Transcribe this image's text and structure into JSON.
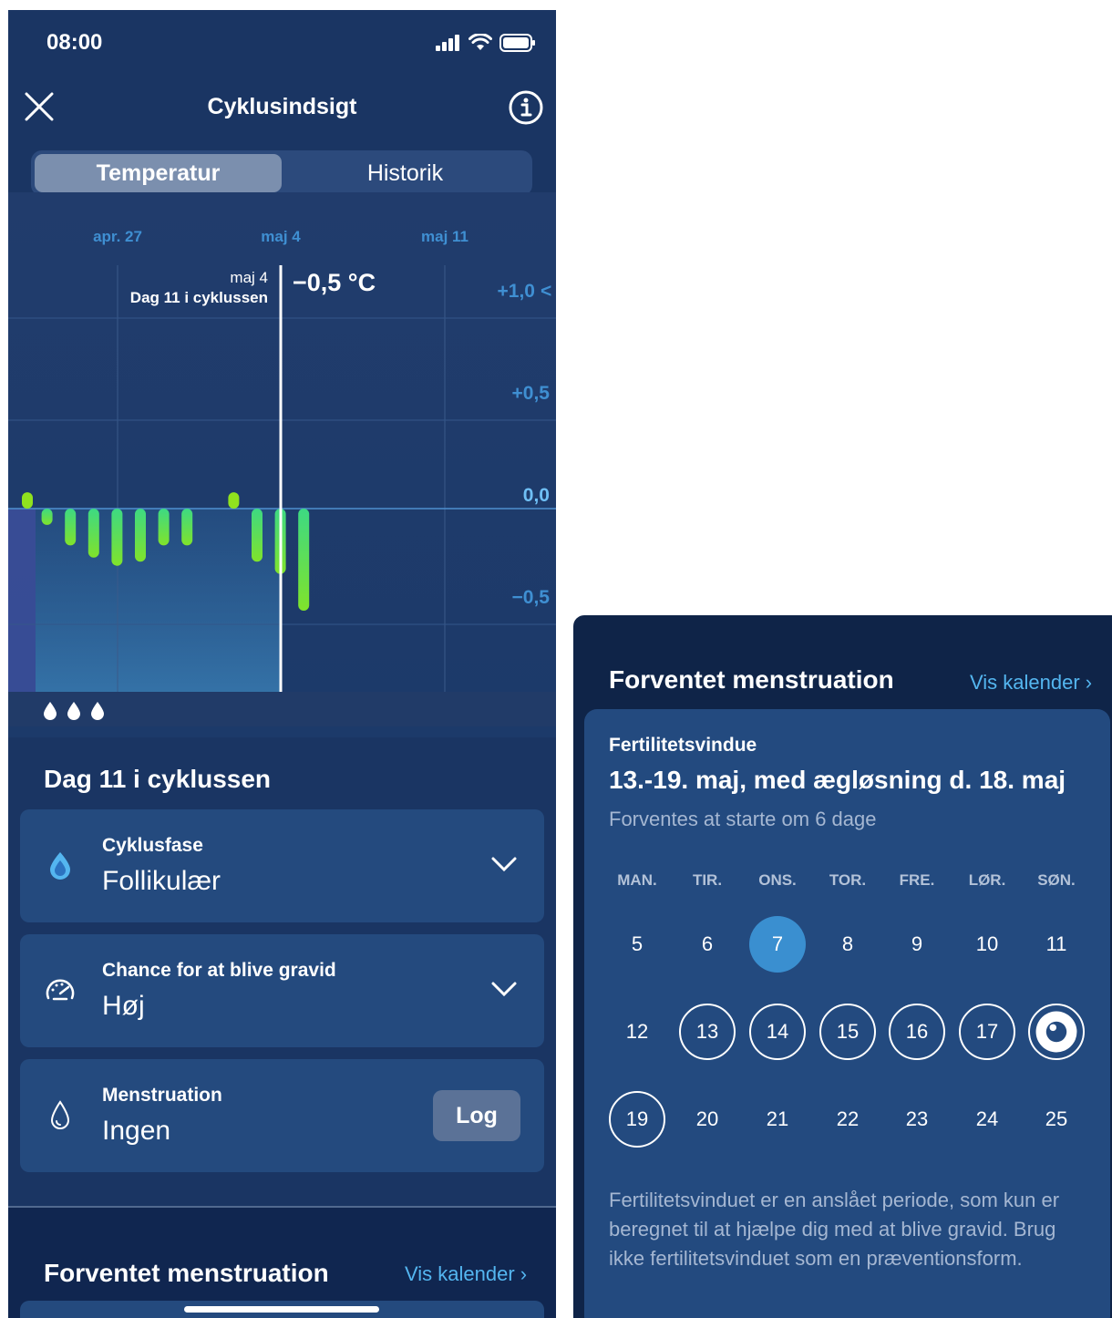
{
  "status_bar": {
    "time": "08:00"
  },
  "header": {
    "title": "Cyklusindsigt"
  },
  "tabs": [
    {
      "label": "Temperatur",
      "active": true
    },
    {
      "label": "Historik",
      "active": false
    }
  ],
  "chart_data": {
    "type": "bar",
    "x_tick_labels": [
      "apr. 27",
      "maj 4",
      "maj 11"
    ],
    "y_tick_labels": [
      "+1,0",
      "+0,5",
      "0,0",
      "−0,5"
    ],
    "ylim": [
      -0.9,
      1.1
    ],
    "values": [
      0.08,
      -0.08,
      -0.18,
      -0.24,
      -0.28,
      -0.26,
      -0.18,
      -0.18,
      null,
      0.08,
      -0.26,
      -0.32,
      -0.5
    ],
    "cursor": {
      "date": "maj 4",
      "cycle_day": "Dag 11 i cyklussen",
      "value": "−0,5 °C"
    },
    "arrow": "<",
    "colors": {
      "positive": "#90e21e",
      "negative_top": "#3dd983",
      "negative_bottom": "#80e32b",
      "line": "#ffffff"
    },
    "period_drops": 3
  },
  "day_section": {
    "heading": "Dag 11 i cyklussen",
    "cards": [
      {
        "label": "Cyklusfase",
        "value": "Follikulær",
        "icon": "cycle-phase-drop-icon"
      },
      {
        "label": "Chance for at blive gravid",
        "value": "Høj",
        "icon": "speedometer-icon"
      },
      {
        "label": "Menstruation",
        "value": "Ingen",
        "icon": "drop-outline-icon",
        "button": "Log"
      }
    ]
  },
  "expected_menstruation": {
    "title": "Forventet menstruation",
    "link": "Vis kalender"
  },
  "fertility": {
    "label": "Fertilitetsvindue",
    "title": "13.-19. maj, med ægløsning d. 18. maj",
    "subtitle": "Forventes at starte om 6 dage",
    "weekdays": [
      "MAN.",
      "TIR.",
      "ONS.",
      "TOR.",
      "FRE.",
      "LØR.",
      "SØN."
    ],
    "weeks": [
      [
        "5",
        "6",
        "7",
        "8",
        "9",
        "10",
        "11"
      ],
      [
        "12",
        "13",
        "14",
        "15",
        "16",
        "17",
        ""
      ],
      [
        "19",
        "20",
        "21",
        "22",
        "23",
        "24",
        "25"
      ]
    ],
    "today": "7",
    "fertile_days": [
      "13",
      "14",
      "15",
      "16",
      "17",
      "19"
    ],
    "ovulation_day": "18",
    "note": "Fertilitetsvinduet er en anslået periode, som kun er beregnet til at hjælpe dig med at blive gravid. Brug ikke fertilitetsvinduet som en præventionsform.",
    "colors": {
      "today": "#3a8fd0",
      "accent_link": "#54b6f0"
    }
  }
}
